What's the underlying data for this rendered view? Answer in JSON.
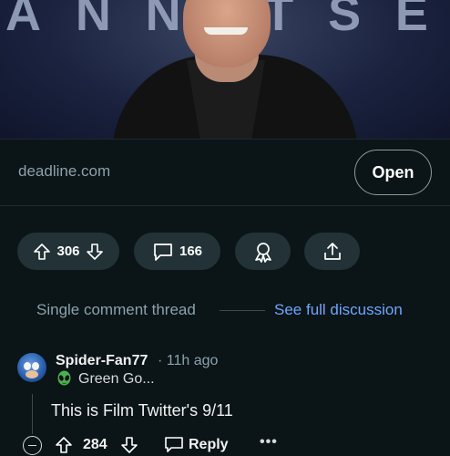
{
  "hero": {
    "background_letters": [
      "A",
      "N",
      "N",
      "I",
      "T",
      "S",
      "E"
    ]
  },
  "link": {
    "domain": "deadline.com",
    "open_label": "Open"
  },
  "actions": {
    "score": "306",
    "comments": "166"
  },
  "thread": {
    "single_label": "Single comment thread",
    "full_link": "See full discussion"
  },
  "comment": {
    "username": "Spider-Fan77",
    "time": "· 11h ago",
    "flair": "Green Go...",
    "body": "This is Film Twitter's 9/11",
    "score": "284",
    "reply_label": "Reply",
    "more_label": "•••"
  },
  "colors": {
    "background": "#0b1416",
    "pill": "#223237",
    "link": "#6ea6ff",
    "muted": "#8ba2ad"
  }
}
